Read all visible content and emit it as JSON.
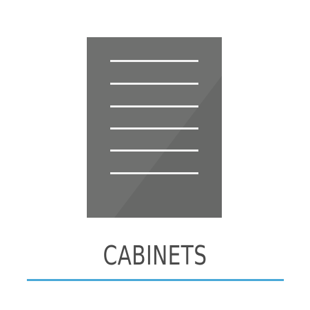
{
  "tile": {
    "label": "CABINETS",
    "icon": "cabinet-door-icon"
  },
  "colors": {
    "background": "#ffffff",
    "icon_fill": "#6f706f",
    "icon_shade": "#676867",
    "icon_lines": "#f2f2f2",
    "label_text": "#4a4a4a",
    "underline": "#4aa9d8"
  }
}
